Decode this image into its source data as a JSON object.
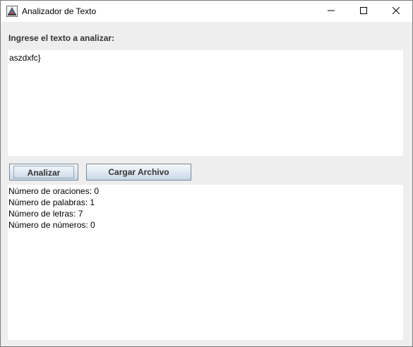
{
  "window": {
    "title": "Analizador de Texto",
    "icon": "java-cup-icon",
    "controls": [
      "minimize-icon",
      "maximize-icon",
      "close-icon"
    ]
  },
  "form": {
    "prompt_label": "Ingrese el texto a analizar:",
    "input_value": "aszdxfc}"
  },
  "buttons": {
    "analyze_label": "Analizar",
    "load_file_label": "Cargar Archivo"
  },
  "results": {
    "sentences": "Número de oraciones: 0",
    "words": "Número de palabras: 1",
    "letters": "Número de letras: 7",
    "numbers": "Número de números: 0"
  }
}
